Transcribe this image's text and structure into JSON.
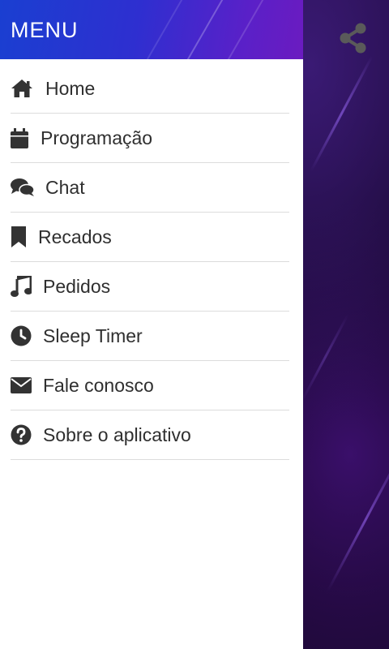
{
  "drawer": {
    "title": "MENU",
    "items": [
      {
        "label": "Home",
        "icon": "home-icon"
      },
      {
        "label": "Programação",
        "icon": "calendar-icon"
      },
      {
        "label": "Chat",
        "icon": "chat-icon"
      },
      {
        "label": "Recados",
        "icon": "bookmark-icon"
      },
      {
        "label": "Pedidos",
        "icon": "music-note-icon"
      },
      {
        "label": "Sleep Timer",
        "icon": "clock-icon"
      },
      {
        "label": "Fale conosco",
        "icon": "envelope-icon"
      },
      {
        "label": "Sobre o aplicativo",
        "icon": "question-circle-icon"
      }
    ]
  },
  "toolbar": {
    "share_icon": "share-icon"
  },
  "colors": {
    "header_start": "#1a3fd1",
    "header_end": "#6b1bc0",
    "icon": "#333333",
    "text": "#2f2f2f",
    "divider": "#dcdcdc"
  }
}
